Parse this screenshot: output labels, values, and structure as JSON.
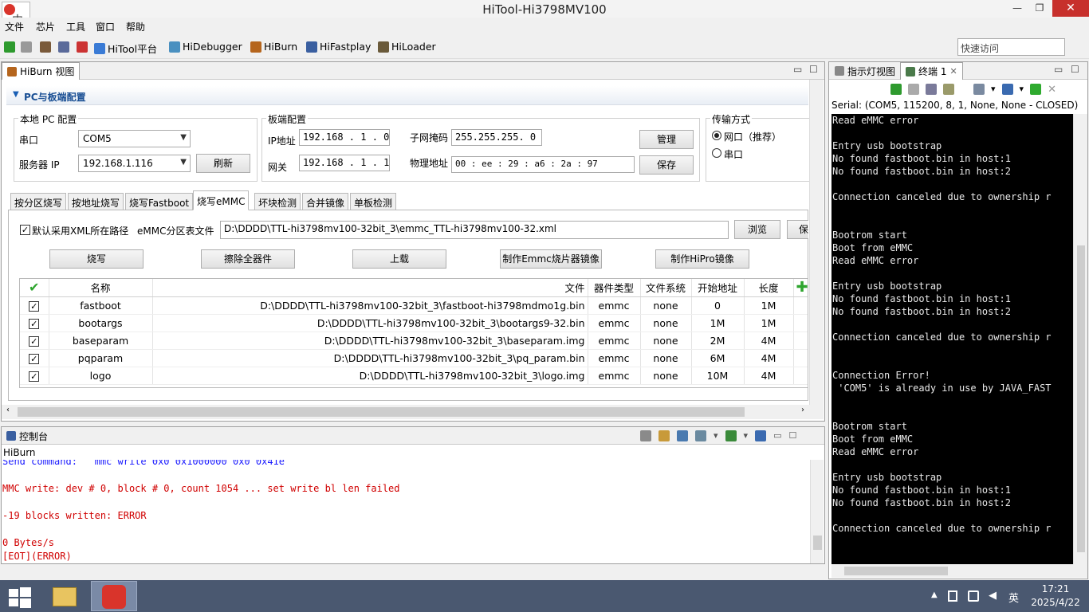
{
  "window": {
    "title": "HiTool-Hi3798MV100",
    "min": "—",
    "max": "❐",
    "close": "✕"
  },
  "appicon": {
    "glyph": "中"
  },
  "menu": [
    "文件",
    "芯片",
    "工具",
    "窗口",
    "帮助"
  ],
  "toolbar": {
    "items": [
      "HiTool平台",
      "HiDebugger",
      "HiBurn",
      "HiFastplay",
      "HiLoader"
    ],
    "quick_access_placeholder": "快速访问"
  },
  "hiburn": {
    "view_title": "HiBurn 视图",
    "section_title": "PC与板端配置",
    "local_pc": {
      "title": "本地 PC 配置",
      "serial_label": "串口",
      "serial_value": "COM5",
      "server_ip_label": "服务器 IP",
      "server_ip_value": "192.168.1.116",
      "refresh": "刷新"
    },
    "board": {
      "title": "板端配置",
      "ip_label": "IP地址",
      "ip_value": "192.168 . 1  . 0",
      "gateway_label": "网关",
      "gateway_value": "192.168 . 1  . 1",
      "mask_label": "子网掩码",
      "mask_value": "255.255.255. 0",
      "mac_label": "物理地址",
      "mac_value": "00  :  ee  :  29  :  a6  :  2a  :  97",
      "manage": "管理",
      "save": "保存"
    },
    "transfer": {
      "title": "传输方式",
      "net": "网口（推荐）",
      "serial": "串口"
    },
    "tabs": [
      "按分区烧写",
      "按地址烧写",
      "烧写Fastboot",
      "烧写eMMC",
      "坏块检测",
      "合并镜像",
      "单板检测"
    ],
    "active_tab": 3,
    "emmc": {
      "use_xml_path": "默认采用XML所在路径",
      "table_file_label": "eMMC分区表文件",
      "table_file_value": "D:\\DDDD\\TTL-hi3798mv100-32bit_3\\emmc_TTL-hi3798mv100-32.xml",
      "browse": "浏览",
      "save_btn": "保"
    },
    "actions": [
      "烧写",
      "擦除全器件",
      "上载",
      "制作Emmc烧片器镜像",
      "制作HiPro镜像"
    ],
    "table": {
      "headers": [
        "名称",
        "文件",
        "器件类型",
        "文件系统",
        "开始地址",
        "长度"
      ],
      "rows": [
        {
          "name": "fastboot",
          "file": "D:\\DDDD\\TTL-hi3798mv100-32bit_3\\fastboot-hi3798mdmo1g.bin",
          "type": "emmc",
          "fs": "none",
          "start": "0",
          "len": "1M"
        },
        {
          "name": "bootargs",
          "file": "D:\\DDDD\\TTL-hi3798mv100-32bit_3\\bootargs9-32.bin",
          "type": "emmc",
          "fs": "none",
          "start": "1M",
          "len": "1M"
        },
        {
          "name": "baseparam",
          "file": "D:\\DDDD\\TTL-hi3798mv100-32bit_3\\baseparam.img",
          "type": "emmc",
          "fs": "none",
          "start": "2M",
          "len": "4M"
        },
        {
          "name": "pqparam",
          "file": "D:\\DDDD\\TTL-hi3798mv100-32bit_3\\pq_param.bin",
          "type": "emmc",
          "fs": "none",
          "start": "6M",
          "len": "4M"
        },
        {
          "name": "logo",
          "file": "D:\\DDDD\\TTL-hi3798mv100-32bit_3\\logo.img",
          "type": "emmc",
          "fs": "none",
          "start": "10M",
          "len": "4M"
        }
      ]
    }
  },
  "console": {
    "title": "控制台",
    "subtitle": "HiBurn",
    "lines": [
      {
        "text": "Send command:   mmc write 0x0 0x1000000 0x0 0x41e",
        "color": "#1a1aff"
      },
      {
        "text": "",
        "color": "#d00000"
      },
      {
        "text": "MMC write: dev # 0, block # 0, count 1054 ... set write bl len failed",
        "color": "#d00000"
      },
      {
        "text": "",
        "color": "#d00000"
      },
      {
        "text": "-19 blocks written: ERROR",
        "color": "#d00000"
      },
      {
        "text": "",
        "color": "#d00000"
      },
      {
        "text": "0 Bytes/s",
        "color": "#d00000"
      },
      {
        "text": "[EOT](ERROR)",
        "color": "#d00000"
      }
    ]
  },
  "right": {
    "tab1": "指示灯视图",
    "tab2": "终端 1",
    "serial_status": "Serial: (COM5, 115200, 8, 1, None, None - CLOSED)",
    "terminal": [
      "Read eMMC error",
      "",
      "Entry usb bootstrap",
      "No found fastboot.bin in host:1",
      "No found fastboot.bin in host:2",
      "",
      "Connection canceled due to ownership r",
      "",
      "",
      "Bootrom start",
      "Boot from eMMC",
      "Read eMMC error",
      "",
      "Entry usb bootstrap",
      "No found fastboot.bin in host:1",
      "No found fastboot.bin in host:2",
      "",
      "Connection canceled due to ownership r",
      "",
      "",
      "Connection Error!",
      " 'COM5' is already in use by JAVA_FAST",
      "",
      "",
      "Bootrom start",
      "Boot from eMMC",
      "Read eMMC error",
      "",
      "Entry usb bootstrap",
      "No found fastboot.bin in host:1",
      "No found fastboot.bin in host:2",
      "",
      "Connection canceled due to ownership r"
    ]
  },
  "taskbar": {
    "time": "17:21",
    "date": "2025/4/22",
    "ime": "英"
  },
  "colors": {
    "accent": "#1a5fb4",
    "title_bg": "#f3f3f3",
    "close": "#c7302c",
    "taskbar": "#4a5870"
  }
}
